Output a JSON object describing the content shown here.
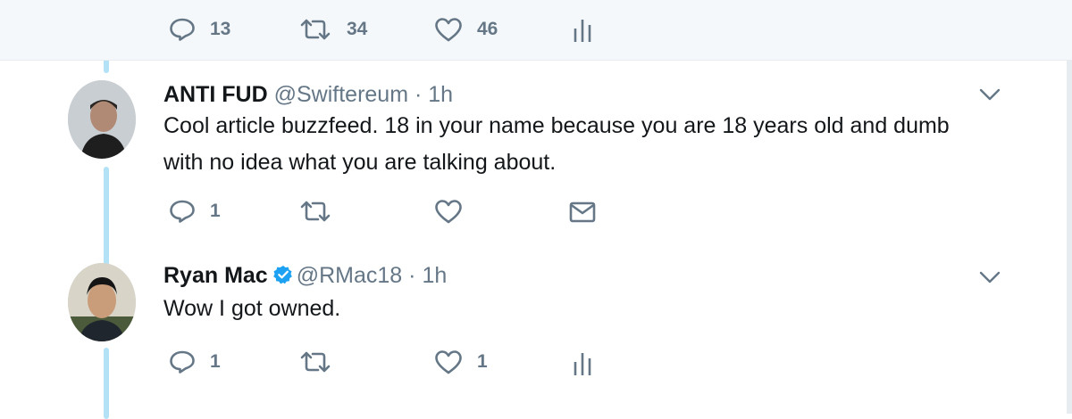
{
  "top_actions": {
    "reply_count": "13",
    "retweet_count": "34",
    "like_count": "46"
  },
  "tweets": [
    {
      "name": "ANTI FUD",
      "handle": "@Swiftereum",
      "separator": "·",
      "time": "1h",
      "text_lines": [
        "Cool article buzzfeed. 18 in your name because you are 18 years old and dumb",
        "with no idea what you are talking about."
      ],
      "reply_count": "1",
      "retweet_count": "",
      "like_count": "",
      "verified": false
    },
    {
      "name": "Ryan Mac",
      "handle": "@RMac18",
      "separator": "·",
      "time": "1h",
      "text_lines": [
        "Wow I got owned."
      ],
      "reply_count": "1",
      "retweet_count": "",
      "like_count": "1",
      "verified": true
    }
  ],
  "colors": {
    "thread_line": "#b3e2f7",
    "action_gray": "#657786",
    "verified_blue": "#1da1f2",
    "top_bar_bg": "#f5f8fa"
  },
  "icons": [
    "reply-icon",
    "retweet-icon",
    "like-icon",
    "analytics-icon",
    "dm-icon",
    "caret-down-icon",
    "verified-badge-icon"
  ]
}
